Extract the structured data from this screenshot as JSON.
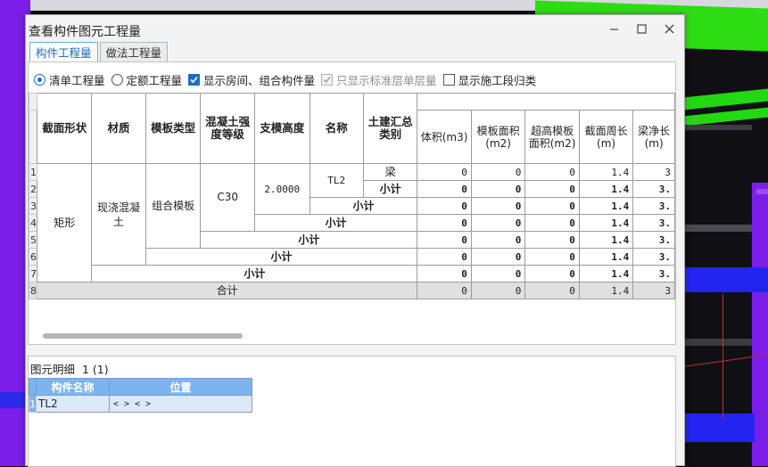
{
  "window": {
    "title": "查看构件图元工程量"
  },
  "tabs": [
    {
      "label": "构件工程量",
      "active": true
    },
    {
      "label": "做法工程量",
      "active": false
    }
  ],
  "options": {
    "qingdan": "清单工程量",
    "dinge": "定额工程量",
    "show_rooms": "显示房间、组合构件量",
    "only_std": "只显示标准层单层量",
    "show_stage": "显示施工段归类"
  },
  "grid": {
    "headers": {
      "section": "截面形状",
      "material": "材质",
      "formwork": "模板类型",
      "concrete": "混凝土强度等级",
      "support": "支模高度",
      "name": "名称",
      "category": "土建汇总类别",
      "volume": "体积(m3)",
      "formarea": "模板面积(m2)",
      "highform": "超高模板面积(m2)",
      "perimeter": "截面周长(m)",
      "beamlen": "梁净长(m)"
    },
    "row_numbers": [
      "1",
      "2",
      "3",
      "4",
      "5",
      "6",
      "7",
      "8"
    ],
    "merged": {
      "section": "矩形",
      "material": "现浇混凝土",
      "formwork": "组合模板",
      "concrete": "C30",
      "support": "2.0000",
      "name": "TL2",
      "category": "梁"
    },
    "subtotal": "小计",
    "total": "合计",
    "rows": [
      {
        "volume": "0",
        "formarea": "0",
        "highform": "0",
        "perimeter": "1.4",
        "beamlen": "3"
      },
      {
        "volume": "0",
        "formarea": "0",
        "highform": "0",
        "perimeter": "1.4",
        "beamlen": "3."
      },
      {
        "volume": "0",
        "formarea": "0",
        "highform": "0",
        "perimeter": "1.4",
        "beamlen": "3."
      },
      {
        "volume": "0",
        "formarea": "0",
        "highform": "0",
        "perimeter": "1.4",
        "beamlen": "3."
      },
      {
        "volume": "0",
        "formarea": "0",
        "highform": "0",
        "perimeter": "1.4",
        "beamlen": "3."
      },
      {
        "volume": "0",
        "formarea": "0",
        "highform": "0",
        "perimeter": "1.4",
        "beamlen": "3."
      },
      {
        "volume": "0",
        "formarea": "0",
        "highform": "0",
        "perimeter": "1.4",
        "beamlen": "3."
      },
      {
        "volume": "0",
        "formarea": "0",
        "highform": "0",
        "perimeter": "1.4",
        "beamlen": "3"
      }
    ]
  },
  "detail": {
    "label": "图元明细",
    "count": "1 (1)",
    "headers": {
      "name": "构件名称",
      "position": "位置"
    },
    "rows": [
      {
        "num": "1",
        "name": "TL2",
        "position": "< > < >"
      }
    ]
  }
}
